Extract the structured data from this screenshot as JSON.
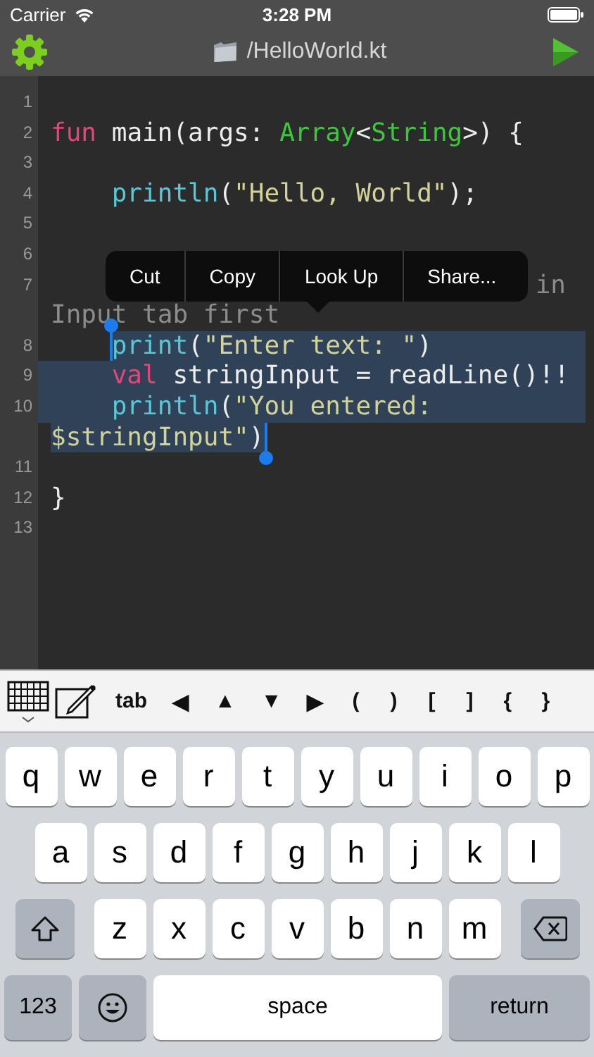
{
  "status_bar": {
    "carrier": "Carrier",
    "time": "3:28 PM"
  },
  "nav_bar": {
    "title": "/HelloWorld.kt"
  },
  "editor": {
    "rows": [
      {
        "number": "1",
        "selected": false,
        "tokens": []
      },
      {
        "number": "2",
        "indented": false,
        "right_aligned": false,
        "selected": false,
        "tokens": [
          {
            "text": "fun",
            "kind": "keyword"
          },
          {
            "text": " main(args: ",
            "kind": "plain"
          },
          {
            "text": "Array",
            "kind": "type"
          },
          {
            "text": "<",
            "kind": "plain"
          },
          {
            "text": "String",
            "kind": "type"
          },
          {
            "text": ">) {",
            "kind": "plain"
          }
        ]
      },
      {
        "number": "3",
        "selected": false,
        "tokens": []
      },
      {
        "number": "4",
        "indented": true,
        "right_aligned": false,
        "selected": false,
        "tokens": [
          {
            "text": "println",
            "kind": "function"
          },
          {
            "text": "(",
            "kind": "plain"
          },
          {
            "text": "\"Hello, World\"",
            "kind": "string"
          },
          {
            "text": ");",
            "kind": "plain"
          }
        ]
      },
      {
        "number": "5",
        "selected": false,
        "tokens": []
      },
      {
        "number": "6",
        "selected": false,
        "tokens": []
      },
      {
        "number": "7",
        "indented": false,
        "right_aligned": true,
        "selected": false,
        "tokens": [
          {
            "text": "in",
            "kind": "comment"
          }
        ]
      },
      {
        "indented": false,
        "right_aligned": false,
        "selected": false,
        "tokens": [
          {
            "text": "Input tab first",
            "kind": "comment"
          }
        ]
      },
      {
        "number": "8",
        "indented": true,
        "right_aligned": false,
        "selected": true,
        "tokens": [
          {
            "text": "print",
            "kind": "function"
          },
          {
            "text": "(",
            "kind": "plain"
          },
          {
            "text": "\"Enter text: \"",
            "kind": "string"
          },
          {
            "text": ")",
            "kind": "plain"
          }
        ]
      },
      {
        "number": "9",
        "indented": true,
        "right_aligned": false,
        "selected": true,
        "tokens": [
          {
            "text": "val",
            "kind": "keyword"
          },
          {
            "text": " stringInput = readLine()!!",
            "kind": "plain"
          }
        ]
      },
      {
        "number": "10",
        "indented": true,
        "right_aligned": false,
        "selected": true,
        "tokens": [
          {
            "text": "println",
            "kind": "function"
          },
          {
            "text": "(",
            "kind": "plain"
          },
          {
            "text": "\"You entered:",
            "kind": "string"
          }
        ]
      },
      {
        "indented": false,
        "right_aligned": false,
        "selected": true,
        "tokens": [
          {
            "text": "$stringInput\"",
            "kind": "string"
          },
          {
            "text": ")",
            "kind": "plain"
          }
        ]
      },
      {
        "number": "11",
        "selected": false,
        "tokens": []
      },
      {
        "number": "12",
        "indented": false,
        "right_aligned": false,
        "selected": false,
        "tokens": [
          {
            "text": "}",
            "kind": "plain"
          }
        ]
      },
      {
        "number": "13",
        "selected": false,
        "tokens": []
      }
    ]
  },
  "context_menu": {
    "items": [
      "Cut",
      "Copy",
      "Look Up",
      "Share..."
    ]
  },
  "accessory_bar": {
    "items": [
      {
        "kind": "keyboard_icon"
      },
      {
        "kind": "pencil_icon"
      },
      {
        "kind": "text",
        "label": "tab"
      },
      {
        "kind": "text",
        "label": "◀"
      },
      {
        "kind": "text",
        "label": "▲"
      },
      {
        "kind": "text",
        "label": "▼"
      },
      {
        "kind": "text",
        "label": "▶"
      },
      {
        "kind": "text",
        "label": "("
      },
      {
        "kind": "text",
        "label": ")"
      },
      {
        "kind": "text",
        "label": "["
      },
      {
        "kind": "text",
        "label": "]"
      },
      {
        "kind": "text",
        "label": "{"
      },
      {
        "kind": "text",
        "label": "}"
      }
    ]
  },
  "keyboard": {
    "rows": [
      {
        "keys": [
          {
            "kind": "letter",
            "label": "q"
          },
          {
            "kind": "letter",
            "label": "w"
          },
          {
            "kind": "letter",
            "label": "e"
          },
          {
            "kind": "letter",
            "label": "r"
          },
          {
            "kind": "letter",
            "label": "t"
          },
          {
            "kind": "letter",
            "label": "y"
          },
          {
            "kind": "letter",
            "label": "u"
          },
          {
            "kind": "letter",
            "label": "i"
          },
          {
            "kind": "letter",
            "label": "o"
          },
          {
            "kind": "letter",
            "label": "p"
          }
        ]
      },
      {
        "keys": [
          {
            "kind": "letter",
            "label": "a"
          },
          {
            "kind": "letter",
            "label": "s"
          },
          {
            "kind": "letter",
            "label": "d"
          },
          {
            "kind": "letter",
            "label": "f"
          },
          {
            "kind": "letter",
            "label": "g"
          },
          {
            "kind": "letter",
            "label": "h"
          },
          {
            "kind": "letter",
            "label": "j"
          },
          {
            "kind": "letter",
            "label": "k"
          },
          {
            "kind": "letter",
            "label": "l"
          }
        ]
      },
      {
        "keys": [
          {
            "kind": "shift"
          },
          {
            "kind": "letter",
            "label": "z"
          },
          {
            "kind": "letter",
            "label": "x"
          },
          {
            "kind": "letter",
            "label": "c"
          },
          {
            "kind": "letter",
            "label": "v"
          },
          {
            "kind": "letter",
            "label": "b"
          },
          {
            "kind": "letter",
            "label": "n"
          },
          {
            "kind": "letter",
            "label": "m"
          },
          {
            "kind": "backspace"
          }
        ]
      },
      {
        "keys": [
          {
            "kind": "numbers",
            "label": "123"
          },
          {
            "kind": "emoji"
          },
          {
            "kind": "space",
            "label": "space"
          },
          {
            "kind": "return",
            "label": "return"
          }
        ]
      }
    ]
  }
}
